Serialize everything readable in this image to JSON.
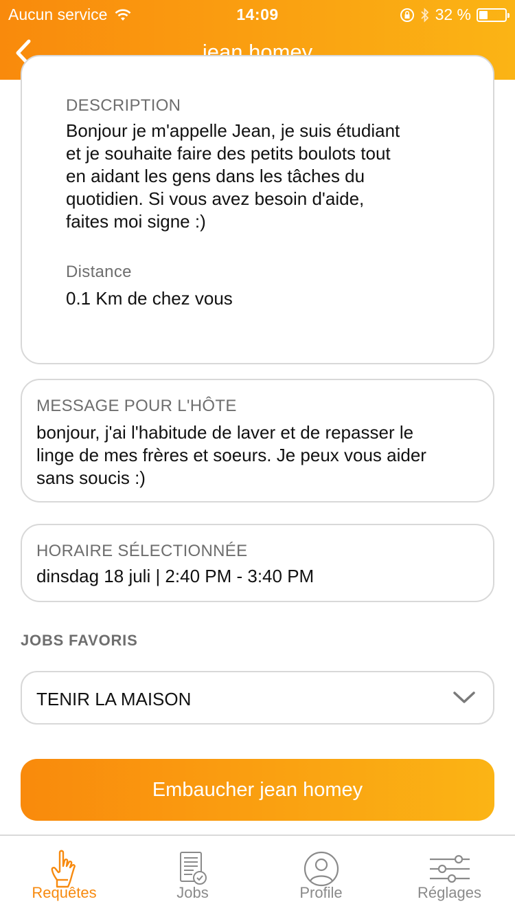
{
  "status_bar": {
    "carrier": "Aucun service",
    "time": "14:09",
    "battery_text": "32 %",
    "battery_level": 0.32
  },
  "nav": {
    "title": "jean homey",
    "back_icon": "chevron-left-icon"
  },
  "profile": {
    "description_label": "DESCRIPTION",
    "description_lines": [
      "Bonjour je m'appelle Jean, je suis étudiant",
      "et je souhaite faire des petits boulots tout",
      "en aidant les gens dans les tâches du",
      "quotidien. Si vous avez besoin d'aide,",
      "faites moi signe :)"
    ],
    "distance_label": "Distance",
    "distance_value": "0.1 Km de chez vous"
  },
  "message": {
    "label": "MESSAGE POUR L'HÔTE",
    "lines": [
      "bonjour, j'ai l'habitude de laver et de repasser le",
      "linge de mes frères et soeurs. Je peux vous aider",
      "sans soucis :)"
    ]
  },
  "schedule": {
    "label": "HORAIRE SÉLECTIONNÉE",
    "value": "dinsdag 18 juli | 2:40 PM - 3:40 PM"
  },
  "favorites": {
    "section_title": "JOBS FAVORIS",
    "selected": "TENIR LA MAISON"
  },
  "hire_button": "Embaucher jean homey",
  "tabs": [
    {
      "label": "Requêtes",
      "icon": "hand-pointer-icon",
      "active": true
    },
    {
      "label": "Jobs",
      "icon": "document-check-icon",
      "active": false
    },
    {
      "label": "Profile",
      "icon": "user-icon",
      "active": false
    },
    {
      "label": "Réglages",
      "icon": "sliders-icon",
      "active": false
    }
  ],
  "colors": {
    "accent_start": "#f98a0c",
    "accent_end": "#fbb415",
    "tab_inactive": "#8a8a8a"
  }
}
